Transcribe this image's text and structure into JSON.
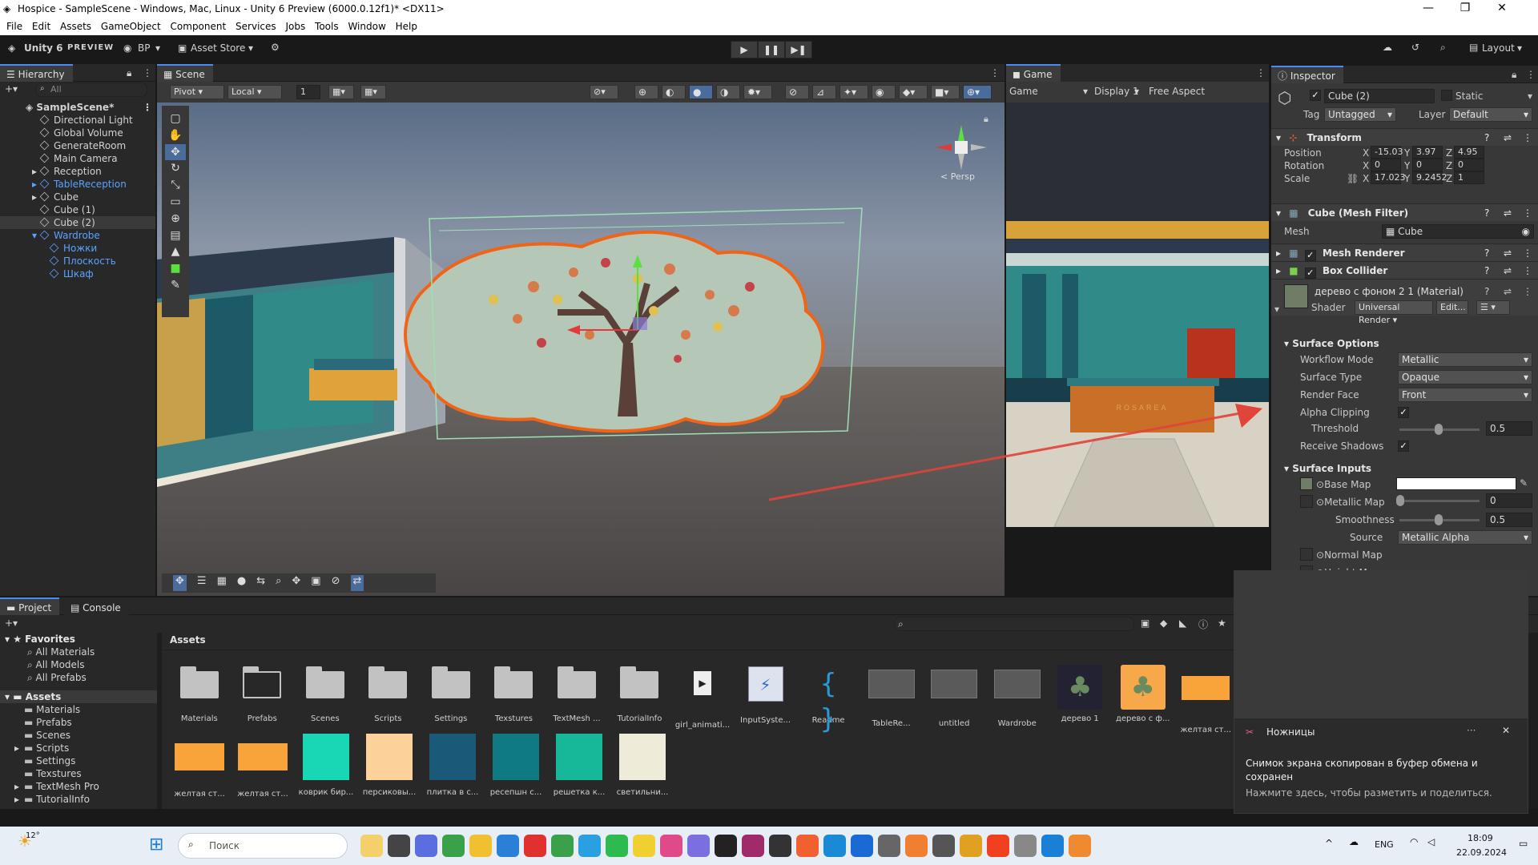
{
  "window": {
    "title": "Hospice - SampleScene - Windows, Mac, Linux - Unity 6 Preview (6000.0.12f1)* <DX11>",
    "min": "—",
    "max": "❐",
    "close": "✕"
  },
  "menu": [
    "File",
    "Edit",
    "Assets",
    "GameObject",
    "Component",
    "Services",
    "Jobs",
    "Tools",
    "Window",
    "Help"
  ],
  "toolbar": {
    "brand": "Unity 6",
    "brand_sub": "PREVIEW",
    "account": "BP",
    "asset_store": "Asset Store",
    "layout": "Layout"
  },
  "hierarchy": {
    "tab": "Hierarchy",
    "search_placeholder": "All",
    "scene": "SampleScene*",
    "items": [
      {
        "label": "Directional Light",
        "indent": 1,
        "blue": false
      },
      {
        "label": "Global Volume",
        "indent": 1,
        "blue": false
      },
      {
        "label": "GenerateRoom",
        "indent": 1,
        "blue": false
      },
      {
        "label": "Main Camera",
        "indent": 1,
        "blue": false
      },
      {
        "label": "Reception",
        "indent": 1,
        "blue": false
      },
      {
        "label": "TableReception",
        "indent": 1,
        "blue": true
      },
      {
        "label": "Cube",
        "indent": 1,
        "blue": false
      },
      {
        "label": "Cube (1)",
        "indent": 1,
        "blue": false
      },
      {
        "label": "Cube (2)",
        "indent": 1,
        "blue": false
      },
      {
        "label": "Wardrobe",
        "indent": 1,
        "blue": true
      },
      {
        "label": "Ножки",
        "indent": 2,
        "blue": true
      },
      {
        "label": "Плоскость",
        "indent": 2,
        "blue": true
      },
      {
        "label": "Шкаф",
        "indent": 2,
        "blue": true
      }
    ]
  },
  "scene": {
    "tab": "Scene",
    "pivot": "Pivot",
    "local": "Local",
    "grid_val": "1",
    "persp": "< Persp"
  },
  "game": {
    "tab": "Game",
    "mode": "Game",
    "display": "Display 1",
    "aspect": "Free Aspect",
    "desk_sign": "ROSAREA"
  },
  "inspector": {
    "tab": "Inspector",
    "object_name": "Cube (2)",
    "static": "Static",
    "tag_label": "Tag",
    "tag": "Untagged",
    "layer_label": "Layer",
    "layer": "Default",
    "transform": {
      "title": "Transform",
      "position": "Position",
      "rotation": "Rotation",
      "scale": "Scale",
      "pos": [
        "-15.03",
        "3.97",
        "4.95"
      ],
      "rot": [
        "0",
        "0",
        "0"
      ],
      "scl": [
        "17.023",
        "9.2452",
        "1"
      ]
    },
    "mesh_filter": {
      "title": "Cube (Mesh Filter)",
      "mesh_label": "Mesh",
      "mesh": "Cube"
    },
    "mesh_renderer": "Mesh Renderer",
    "box_collider": "Box Collider",
    "material": {
      "name": "дерево с фоном 2 1 (Material)",
      "shader_label": "Shader",
      "shader": "Universal Render",
      "edit": "Edit..."
    },
    "surface_options": {
      "title": "Surface Options",
      "workflow_label": "Workflow Mode",
      "workflow": "Metallic",
      "surface_label": "Surface Type",
      "surface": "Opaque",
      "render_face_label": "Render Face",
      "render_face": "Front",
      "alpha_label": "Alpha Clipping",
      "threshold_label": "Threshold",
      "threshold": "0.5",
      "receive_label": "Receive Shadows"
    },
    "surface_inputs": {
      "title": "Surface Inputs",
      "base_map": "Base Map",
      "metallic_map": "Metallic Map",
      "metallic": "0",
      "smoothness_label": "Smoothness",
      "smoothness": "0.5",
      "source_label": "Source",
      "source": "Metallic Alpha",
      "normal_map": "Normal Map",
      "height_map": "Height Map"
    }
  },
  "project": {
    "tab_project": "Project",
    "tab_console": "Console",
    "breadcrumb": "Assets",
    "favorites": "Favorites",
    "fav_items": [
      "All Materials",
      "All Models",
      "All Prefabs"
    ],
    "assets_root": "Assets",
    "tree": [
      "Materials",
      "Prefabs",
      "Scenes",
      "Scripts",
      "Settings",
      "Texstures",
      "TextMesh Pro",
      "TutorialInfo"
    ],
    "row1": [
      {
        "label": "Materials",
        "kind": "folder"
      },
      {
        "label": "Prefabs",
        "kind": "folder-empty"
      },
      {
        "label": "Scenes",
        "kind": "folder"
      },
      {
        "label": "Scripts",
        "kind": "folder"
      },
      {
        "label": "Settings",
        "kind": "folder"
      },
      {
        "label": "Texstures",
        "kind": "folder"
      },
      {
        "label": "TextMesh ...",
        "kind": "folder"
      },
      {
        "label": "TutorialInfo",
        "kind": "folder"
      },
      {
        "label": "girl_animati...",
        "kind": "video"
      },
      {
        "label": "InputSyste...",
        "kind": "input"
      },
      {
        "label": "Readme",
        "kind": "readme"
      },
      {
        "label": "TableRe...",
        "kind": "prefab"
      },
      {
        "label": "untitled",
        "kind": "prefab"
      },
      {
        "label": "Wardrobe",
        "kind": "prefab"
      },
      {
        "label": "дерево 1",
        "kind": "tree"
      },
      {
        "label": "дерево с ф...",
        "kind": "tree2"
      },
      {
        "label": "желтая ст...",
        "kind": "orange"
      }
    ],
    "row2": [
      {
        "label": "желтая ст...",
        "color": "#f8a43a"
      },
      {
        "label": "желтая ст...",
        "color": "#f8a43a"
      },
      {
        "label": "коврик бир...",
        "color": "#19d6b4"
      },
      {
        "label": "персиковы...",
        "color": "#fcd29a"
      },
      {
        "label": "плитка в с...",
        "color": "#1a5a78"
      },
      {
        "label": "ресепшн с...",
        "color": "#0f7a82"
      },
      {
        "label": "решетка к...",
        "color": "#17b79a"
      },
      {
        "label": "светильни...",
        "color": "#eeecd8"
      }
    ]
  },
  "toast": {
    "app": "Ножницы",
    "line1": "Снимок экрана скопирован в буфер обмена и сохранен",
    "line2": "Нажмите здесь, чтобы разметить и поделиться."
  },
  "taskbar": {
    "temp": "12°",
    "search": "Поиск",
    "lang": "ENG",
    "time": "18:09",
    "date": "22.09.2024"
  }
}
